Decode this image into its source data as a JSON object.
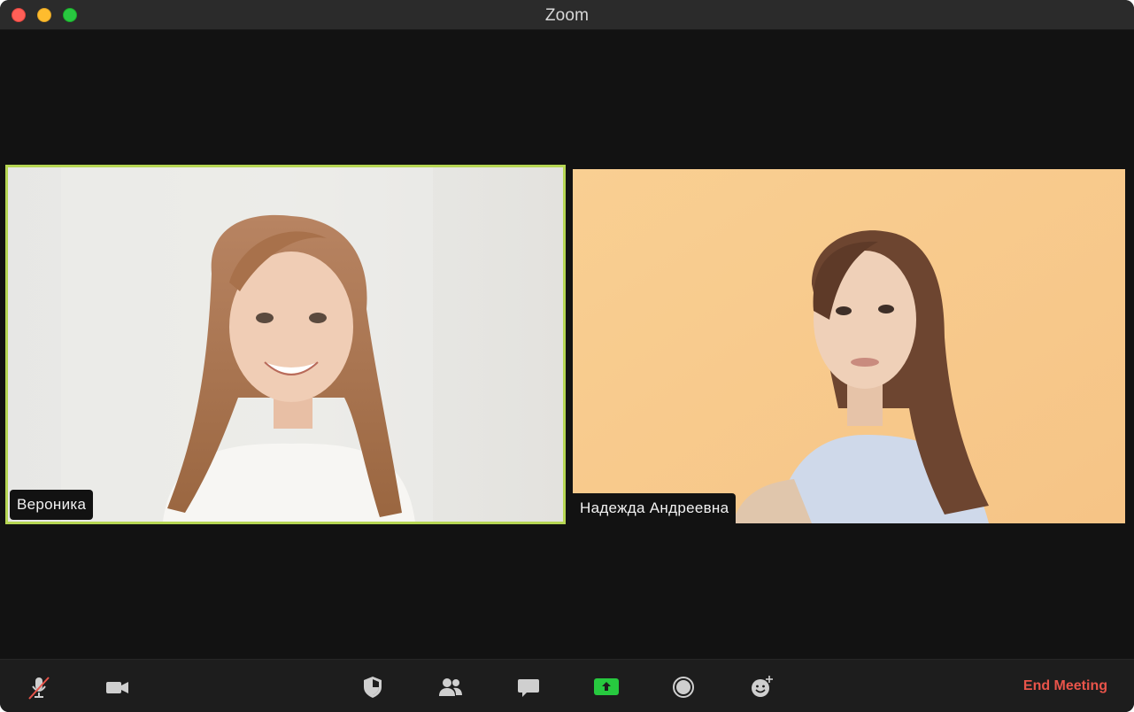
{
  "window": {
    "title": "Zoom"
  },
  "participants": [
    {
      "name": "Вероника",
      "active_speaker": true
    },
    {
      "name": "Надежда Андреевна",
      "active_speaker": false
    }
  ],
  "toolbar": {
    "buttons": [
      {
        "icon": "microphone-muted-icon"
      },
      {
        "icon": "video-camera-icon"
      },
      {
        "icon": "security-shield-icon"
      },
      {
        "icon": "participants-icon"
      },
      {
        "icon": "chat-icon"
      },
      {
        "icon": "share-screen-icon"
      },
      {
        "icon": "record-icon"
      },
      {
        "icon": "reactions-icon"
      }
    ],
    "end_meeting_label": "End Meeting"
  },
  "colors": {
    "active_speaker_border": "#b6d653",
    "share_button": "#27c93f",
    "end_meeting": "#e9544a",
    "window_bg": "#121212"
  }
}
